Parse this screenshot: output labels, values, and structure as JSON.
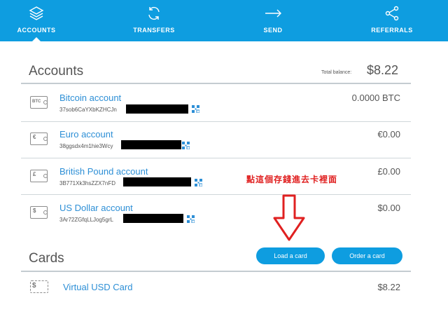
{
  "nav": {
    "items": [
      {
        "label": "ACCOUNTS",
        "icon": "layers-icon",
        "active": true
      },
      {
        "label": "TRANSFERS",
        "icon": "refresh-icon",
        "active": false
      },
      {
        "label": "SEND",
        "icon": "arrow-right-icon",
        "active": false
      },
      {
        "label": "REFERRALS",
        "icon": "share-icon",
        "active": false
      }
    ]
  },
  "accounts": {
    "title": "Accounts",
    "total_label": "Total balance:",
    "total_value": "$8.22",
    "list": [
      {
        "name": "Bitcoin account",
        "address": "37sob6CaYXbKZHCJn",
        "balance": "0.0000 BTC",
        "symbol": "BTC"
      },
      {
        "name": "Euro account",
        "address": "38ggsdx4m1hie3Wcy",
        "balance": "€0.00",
        "symbol": "€"
      },
      {
        "name": "British Pound account",
        "address": "3B771Xk3hsZZX7nFD",
        "balance": "£0.00",
        "symbol": "£"
      },
      {
        "name": "US Dollar account",
        "address": "3Ar72ZGfqLLJog5grL",
        "balance": "$0.00",
        "symbol": "$"
      }
    ]
  },
  "annotation": {
    "text": "點這個存錢進去卡裡面",
    "color": "#e02020"
  },
  "cards": {
    "title": "Cards",
    "load_button": "Load a card",
    "order_button": "Order a card",
    "list": [
      {
        "name": "Virtual USD Card",
        "balance": "$8.22",
        "symbol": "$"
      }
    ]
  },
  "colors": {
    "brand": "#0e9de0",
    "link": "#2d8fd6",
    "annotation": "#e02020"
  }
}
